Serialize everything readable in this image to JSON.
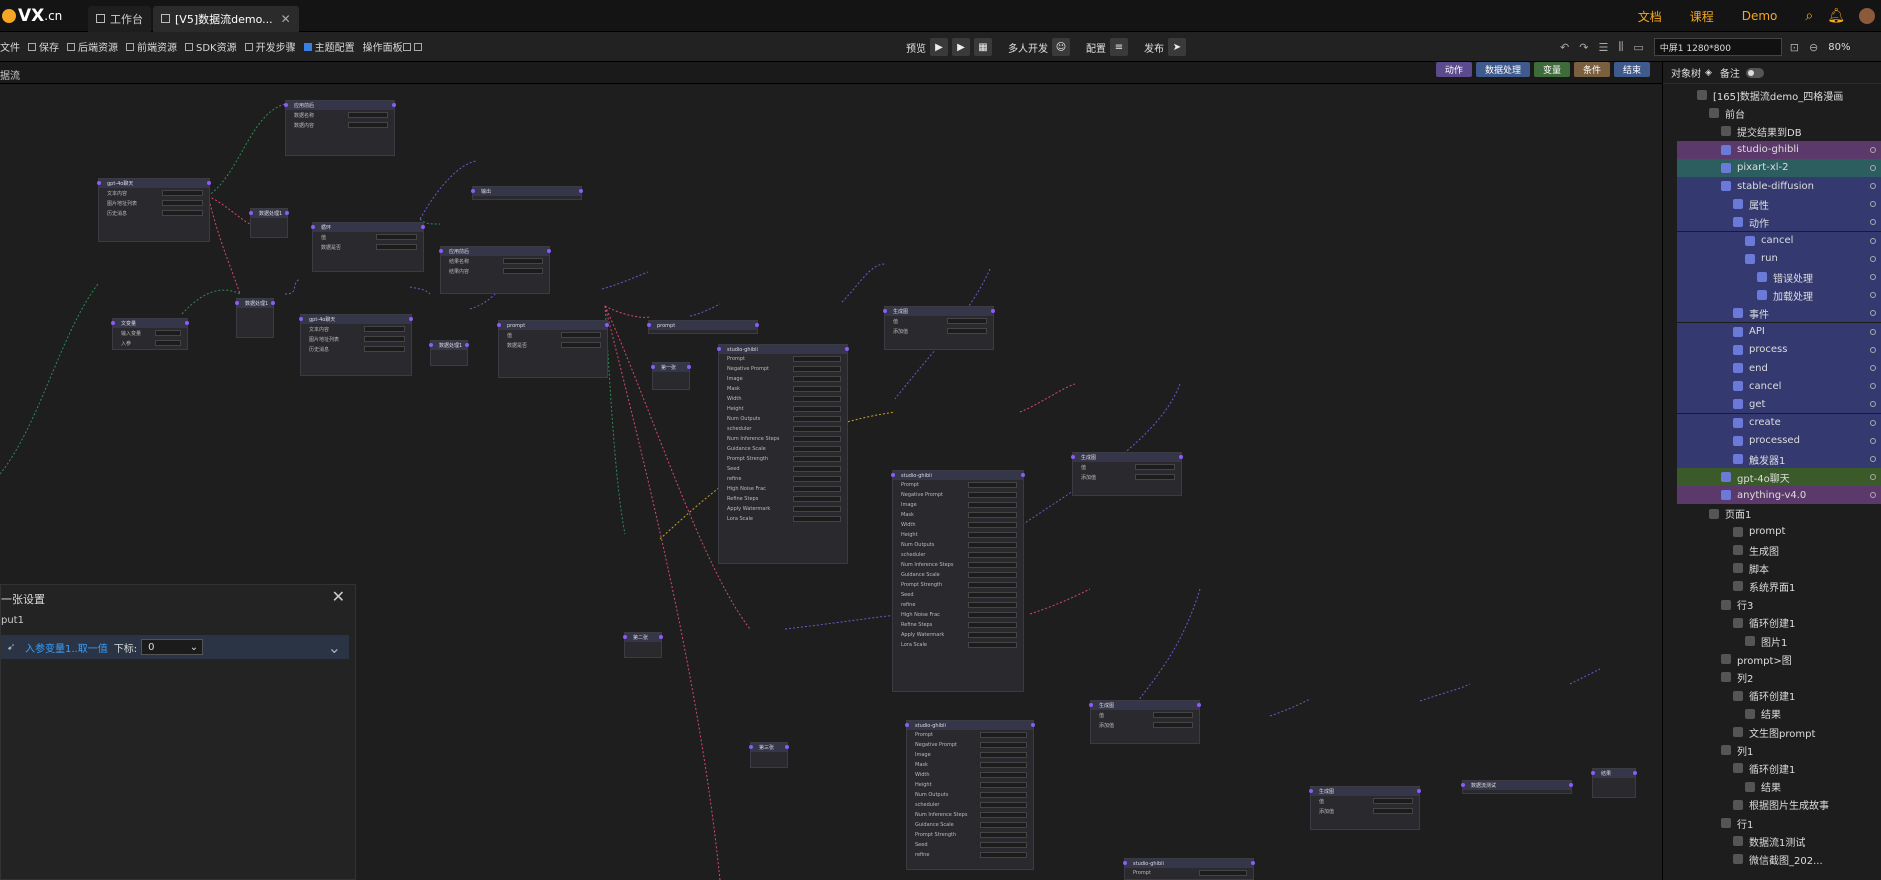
{
  "app": {
    "logo_text": "VX",
    "logo_suffix": ".cn"
  },
  "tabs": [
    {
      "label": "工作台",
      "active": false
    },
    {
      "label": "[V5]数据流demo...",
      "active": true
    }
  ],
  "top_links": [
    "文档",
    "课程",
    "Demo"
  ],
  "toolbar": {
    "items": [
      "文件",
      "保存",
      "后端资源",
      "前端资源",
      "SDK资源",
      "开发步骤",
      "主题配置",
      "操作面板"
    ],
    "preview_label": "预览",
    "collab_label": "多人开发",
    "config_label": "配置",
    "publish_label": "发布",
    "screen_value": "中屏1 1280*800",
    "zoom": "80%"
  },
  "subbar": {
    "title": "据流"
  },
  "legend": [
    {
      "label": "动作",
      "color": "#5b4a8c"
    },
    {
      "label": "数据处理",
      "color": "#3f5a8c"
    },
    {
      "label": "变量",
      "color": "#3f6b3a"
    },
    {
      "label": "条件",
      "color": "#7b6040"
    },
    {
      "label": "结束",
      "color": "#3f5a8c"
    }
  ],
  "nodes": [
    {
      "title": "应用前后",
      "rows": [
        "数据名称",
        "数据内容"
      ]
    },
    {
      "title": "gpt-4o聊天",
      "rows": [
        "文本内容",
        "图片地址列表",
        "历史消息"
      ]
    },
    {
      "title": "数据处理1",
      "rows": []
    },
    {
      "title": "循环",
      "rows": [
        "值",
        "数据是否"
      ]
    },
    {
      "title": "输出",
      "rows": []
    },
    {
      "title": "应用前后",
      "rows": [
        "结果名称",
        "结果内容"
      ]
    },
    {
      "title": "文变量",
      "rows": [
        "输入变量",
        "入参"
      ]
    },
    {
      "title": "数据处理1",
      "rows": []
    },
    {
      "title": "gpt-4o聊天",
      "rows": [
        "文本内容",
        "图片地址列表",
        "历史消息"
      ]
    },
    {
      "title": "数据处理1",
      "rows": []
    },
    {
      "title": "prompt",
      "rows": [
        "值",
        "数据是否"
      ]
    },
    {
      "title": "prompt",
      "rows": []
    },
    {
      "title": "第一张",
      "rows": []
    },
    {
      "title": "studio-ghibli",
      "rows": [
        "Prompt",
        "Negative Prompt",
        "Image",
        "Mask",
        "Width",
        "Height",
        "Num Outputs",
        "scheduler",
        "Num Inference Steps",
        "Guidance Scale",
        "Prompt Strength",
        "Seed",
        "refine",
        "High Noise Frac",
        "Refine Steps",
        "Apply Watermark",
        "Lora Scale"
      ]
    },
    {
      "title": "生成图",
      "rows": [
        "值",
        "添加值"
      ]
    },
    {
      "title": "studio-ghibli",
      "rows": [
        "Prompt",
        "Negative Prompt",
        "Image",
        "Mask",
        "Width",
        "Height",
        "Num Outputs",
        "scheduler",
        "Num Inference Steps",
        "Guidance Scale",
        "Prompt Strength",
        "Seed",
        "refine",
        "High Noise Frac",
        "Refine Steps",
        "Apply Watermark",
        "Lora Scale"
      ]
    },
    {
      "title": "生成图",
      "rows": [
        "值",
        "添加值"
      ]
    },
    {
      "title": "第二张",
      "rows": []
    },
    {
      "title": "第三张",
      "rows": []
    },
    {
      "title": "studio-ghibli",
      "rows": [
        "Prompt",
        "Negative Prompt",
        "Image",
        "Mask",
        "Width",
        "Height",
        "Num Outputs",
        "scheduler",
        "Num Inference Steps",
        "Guidance Scale",
        "Prompt Strength",
        "Seed",
        "refine"
      ]
    },
    {
      "title": "生成图",
      "rows": [
        "值",
        "添加值"
      ]
    },
    {
      "title": "生成图",
      "rows": [
        "值",
        "添加值"
      ]
    },
    {
      "title": "数据流测试",
      "rows": []
    },
    {
      "title": "结果",
      "rows": []
    },
    {
      "title": "studio-ghibli",
      "rows": [
        "Prompt"
      ]
    }
  ],
  "settings": {
    "title": "一张设置",
    "name": "put1",
    "row_label": "入参变量1..取一值",
    "row_sub": "下标:",
    "row_value": "0"
  },
  "sidebar": {
    "tab_objects": "对象树",
    "tab_notes": "备注",
    "tree": [
      {
        "label": "[165]数据流demo_四格漫画",
        "indent": 1,
        "bg": ""
      },
      {
        "label": "前台",
        "indent": 2,
        "bg": ""
      },
      {
        "label": "提交结果到DB",
        "indent": 3,
        "bg": ""
      },
      {
        "label": "studio-ghibli",
        "indent": 3,
        "bg": "#5b3a6b"
      },
      {
        "label": "pixart-xl-2",
        "indent": 3,
        "bg": "#2c5e60"
      },
      {
        "label": "stable-diffusion",
        "indent": 3,
        "bg": "#343a70"
      },
      {
        "label": "属性",
        "indent": 4,
        "bg": "#343a70"
      },
      {
        "label": "动作",
        "indent": 4,
        "bg": "#343a70"
      },
      {
        "label": "cancel",
        "indent": 5,
        "bg": "#343a70"
      },
      {
        "label": "run",
        "indent": 5,
        "bg": "#343a70"
      },
      {
        "label": "错误处理",
        "indent": 6,
        "bg": "#343a70"
      },
      {
        "label": "加载处理",
        "indent": 6,
        "bg": "#343a70"
      },
      {
        "label": "事件",
        "indent": 4,
        "bg": "#343a70"
      },
      {
        "label": "API",
        "indent": 4,
        "bg": "#343a70"
      },
      {
        "label": "process",
        "indent": 4,
        "bg": "#343a70"
      },
      {
        "label": "end",
        "indent": 4,
        "bg": "#343a70"
      },
      {
        "label": "cancel",
        "indent": 4,
        "bg": "#343a70"
      },
      {
        "label": "get",
        "indent": 4,
        "bg": "#343a70"
      },
      {
        "label": "create",
        "indent": 4,
        "bg": "#343a70"
      },
      {
        "label": "processed",
        "indent": 4,
        "bg": "#343a70"
      },
      {
        "label": "触发器1",
        "indent": 4,
        "bg": "#343a70"
      },
      {
        "label": "gpt-4o聊天",
        "indent": 3,
        "bg": "#3a5a2a"
      },
      {
        "label": "anything-v4.0",
        "indent": 3,
        "bg": "#5b3a6b"
      },
      {
        "label": "页面1",
        "indent": 2,
        "bg": ""
      },
      {
        "label": "prompt",
        "indent": 4,
        "bg": ""
      },
      {
        "label": "生成图",
        "indent": 4,
        "bg": ""
      },
      {
        "label": "脚本",
        "indent": 4,
        "bg": ""
      },
      {
        "label": "系统界面1",
        "indent": 4,
        "bg": ""
      },
      {
        "label": "行3",
        "indent": 3,
        "bg": ""
      },
      {
        "label": "循环创建1",
        "indent": 4,
        "bg": ""
      },
      {
        "label": "图片1",
        "indent": 5,
        "bg": ""
      },
      {
        "label": "prompt>图",
        "indent": 3,
        "bg": ""
      },
      {
        "label": "列2",
        "indent": 3,
        "bg": ""
      },
      {
        "label": "循环创建1",
        "indent": 4,
        "bg": ""
      },
      {
        "label": "结果",
        "indent": 5,
        "bg": ""
      },
      {
        "label": "文生图prompt",
        "indent": 4,
        "bg": ""
      },
      {
        "label": "列1",
        "indent": 3,
        "bg": ""
      },
      {
        "label": "循环创建1",
        "indent": 4,
        "bg": ""
      },
      {
        "label": "结果",
        "indent": 5,
        "bg": ""
      },
      {
        "label": "根据图片生成故事",
        "indent": 4,
        "bg": ""
      },
      {
        "label": "行1",
        "indent": 3,
        "bg": ""
      },
      {
        "label": "数据流1测试",
        "indent": 4,
        "bg": ""
      },
      {
        "label": "微信截图_202...",
        "indent": 4,
        "bg": ""
      }
    ]
  }
}
